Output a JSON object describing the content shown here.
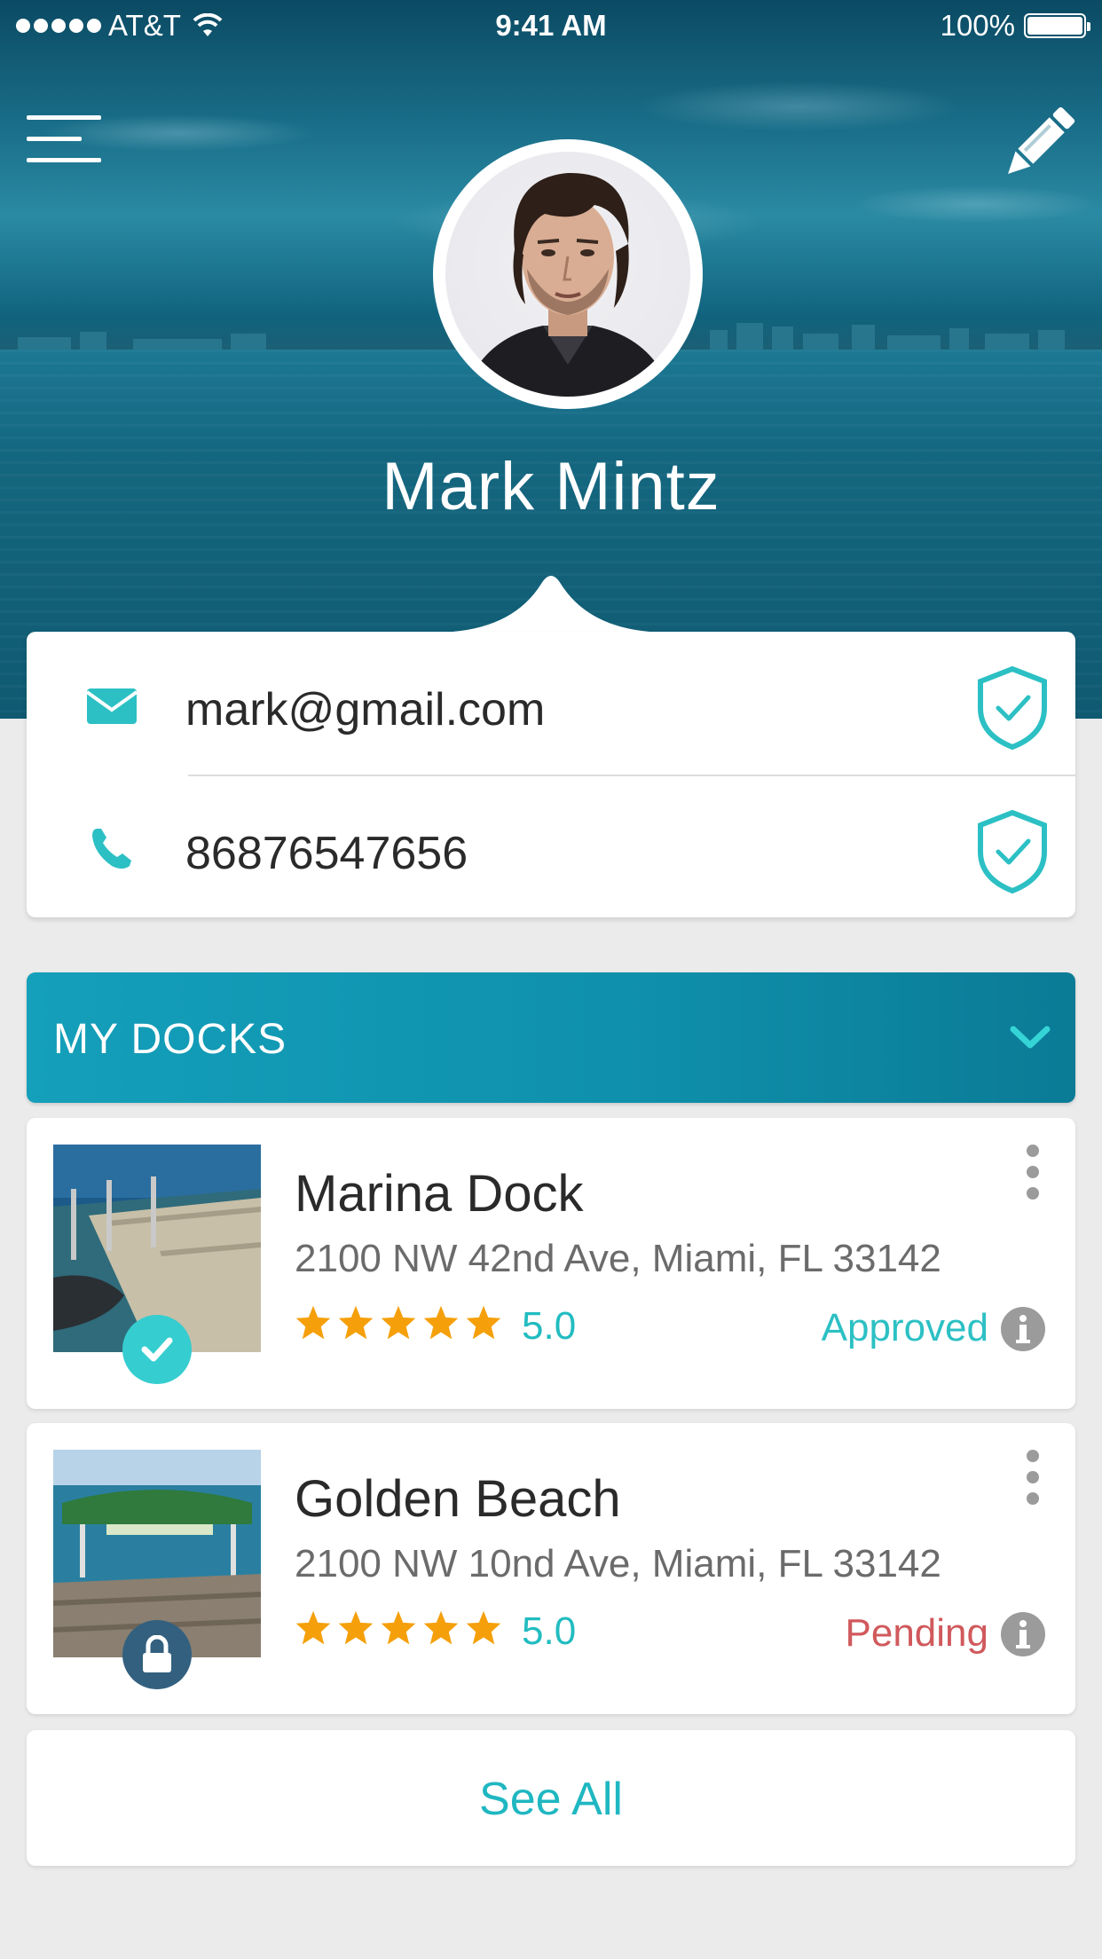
{
  "status_bar": {
    "carrier": "AT&T",
    "time": "9:41 AM",
    "battery": "100%",
    "battery_level": 1.0
  },
  "header": {
    "menu_icon": "hamburger-menu-icon",
    "edit_icon": "pencil-icon"
  },
  "profile": {
    "name": "Mark Mintz",
    "avatar": "profile-photo"
  },
  "contact": {
    "email": "mark@gmail.com",
    "phone": "86876547656",
    "email_icon": "envelope-icon",
    "phone_icon": "phone-icon",
    "verified_icon": "shield-check-icon"
  },
  "docks": {
    "header_label": "MY DOCKS",
    "items": [
      {
        "name": "Marina Dock",
        "address": "2100 NW 42nd Ave, Miami, FL 33142",
        "rating": "5.0",
        "stars": 5,
        "status": "Approved",
        "status_color": "#2cc0c4",
        "badge_icon": "check-icon",
        "badge_color": "#35cdd0"
      },
      {
        "name": "Golden Beach",
        "address": "2100 NW 10nd Ave, Miami, FL 33142",
        "rating": "5.0",
        "stars": 5,
        "status": "Pending",
        "status_color": "#d0595c",
        "badge_icon": "lock-icon",
        "badge_color": "#33607f"
      }
    ],
    "see_all_label": "See All"
  },
  "colors": {
    "accent": "#22bcc0",
    "star": "#f5a00b",
    "header_teal": "#1199b5"
  }
}
